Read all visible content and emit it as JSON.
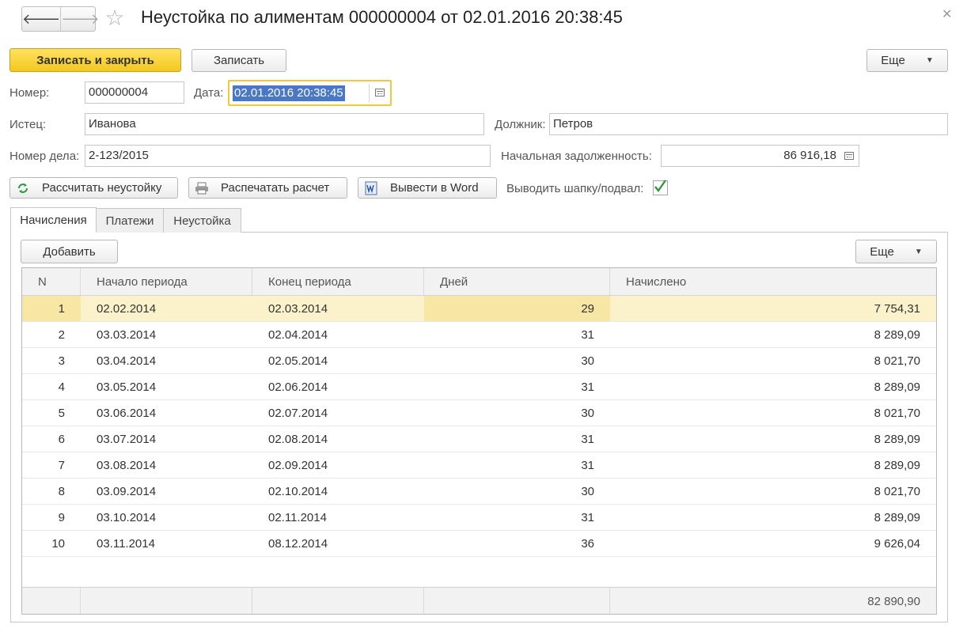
{
  "window": {
    "title": "Неустойка по алиментам 000000004 от 02.01.2016 20:38:45",
    "back_glyph": "🡐",
    "forward_glyph": "🡒",
    "favorite_glyph": "☆",
    "close_glyph": "✕"
  },
  "toolbar": {
    "save_close_label": "Записать и закрыть",
    "save_label": "Записать",
    "more_label": "Еще"
  },
  "form": {
    "number_label": "Номер:",
    "number_value": "000000004",
    "date_label": "Дата:",
    "date_value": "02.01.2016 20:38:45",
    "plaintiff_label": "Истец:",
    "plaintiff_value": "Иванова",
    "debtor_label": "Должник:",
    "debtor_value": "Петров",
    "case_label": "Номер дела:",
    "case_value": "2-123/2015",
    "initial_debt_label": "Начальная задолженность:",
    "initial_debt_value": "86 916,18"
  },
  "actions": {
    "calculate_label": "Рассчитать неустойку",
    "print_label": "Распечатать расчет",
    "word_label": "Вывести в Word",
    "header_footer_label": "Выводить шапку/подвал:",
    "header_footer_checked": true
  },
  "tabs": [
    {
      "label": "Начисления",
      "active": true
    },
    {
      "label": "Платежи",
      "active": false
    },
    {
      "label": "Неустойка",
      "active": false
    }
  ],
  "table_toolbar": {
    "add_label": "Добавить",
    "more_label": "Еще"
  },
  "table": {
    "columns": [
      "N",
      "Начало периода",
      "Конец периода",
      "Дней",
      "Начислено"
    ],
    "rows": [
      [
        "1",
        "02.02.2014",
        "02.03.2014",
        "29",
        "7 754,31"
      ],
      [
        "2",
        "03.03.2014",
        "02.04.2014",
        "31",
        "8 289,09"
      ],
      [
        "3",
        "03.04.2014",
        "02.05.2014",
        "30",
        "8 021,70"
      ],
      [
        "4",
        "03.05.2014",
        "02.06.2014",
        "31",
        "8 289,09"
      ],
      [
        "5",
        "03.06.2014",
        "02.07.2014",
        "30",
        "8 021,70"
      ],
      [
        "6",
        "03.07.2014",
        "02.08.2014",
        "31",
        "8 289,09"
      ],
      [
        "7",
        "03.08.2014",
        "02.09.2014",
        "31",
        "8 289,09"
      ],
      [
        "8",
        "03.09.2014",
        "02.10.2014",
        "30",
        "8 021,70"
      ],
      [
        "9",
        "03.10.2014",
        "02.11.2014",
        "31",
        "8 289,09"
      ],
      [
        "10",
        "03.11.2014",
        "08.12.2014",
        "36",
        "9 626,04"
      ]
    ],
    "selected_row": 0,
    "total": "82 890,90"
  },
  "colors": {
    "primary_button": "#f5cd2a",
    "focus_border": "#f5c838",
    "selection": "#4a78c6",
    "selected_row": "#fbf2cb",
    "check_mark": "#2e9a3c"
  }
}
